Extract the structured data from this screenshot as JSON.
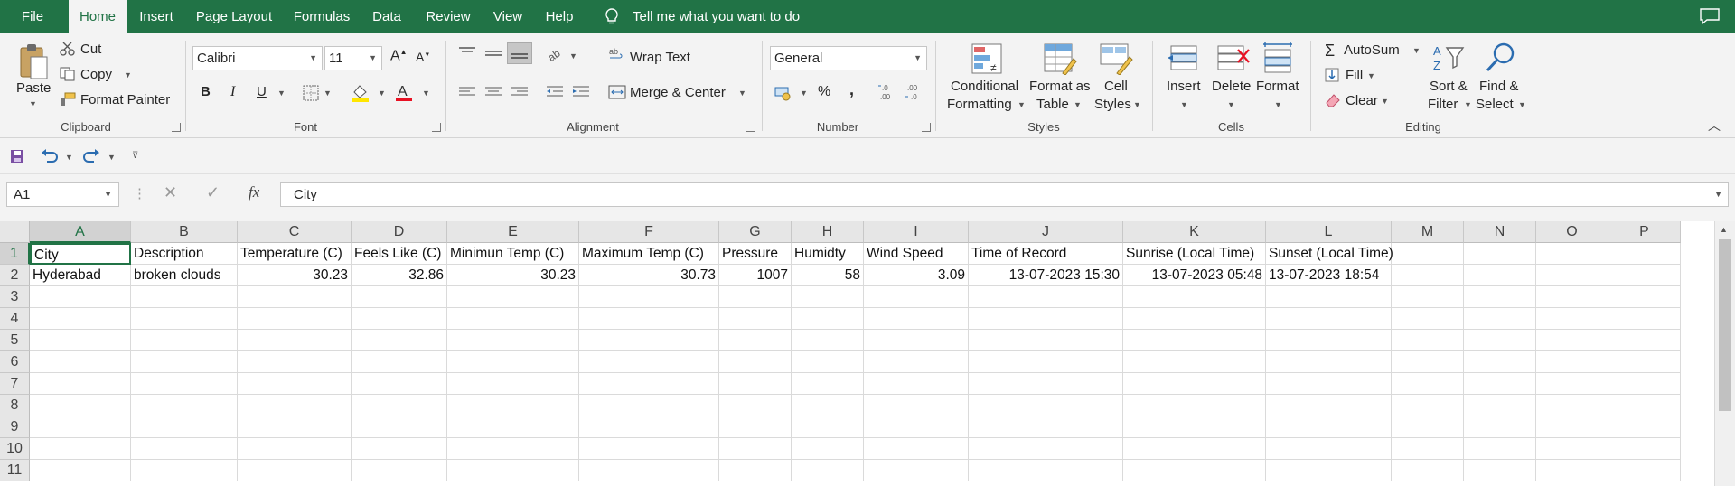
{
  "tabs": [
    "File",
    "Home",
    "Insert",
    "Page Layout",
    "Formulas",
    "Data",
    "Review",
    "View",
    "Help"
  ],
  "active_tab": "Home",
  "tell_me": "Tell me what you want to do",
  "ribbon": {
    "clipboard": {
      "paste": "Paste",
      "cut": "Cut",
      "copy": "Copy",
      "format_painter": "Format Painter",
      "label": "Clipboard"
    },
    "font": {
      "name": "Calibri",
      "size": "11",
      "bold": "B",
      "italic": "I",
      "underline": "U",
      "label": "Font"
    },
    "alignment": {
      "wrap_text": "Wrap Text",
      "merge_center": "Merge & Center",
      "label": "Alignment"
    },
    "number": {
      "format": "General",
      "percent": "%",
      "comma": ",",
      "label": "Number"
    },
    "styles": {
      "conditional_1": "Conditional",
      "conditional_2": "Formatting",
      "format_table_1": "Format as",
      "format_table_2": "Table",
      "cell_styles_1": "Cell",
      "cell_styles_2": "Styles",
      "label": "Styles"
    },
    "cells": {
      "insert": "Insert",
      "delete": "Delete",
      "format": "Format",
      "label": "Cells"
    },
    "editing": {
      "autosum": "AutoSum",
      "fill": "Fill",
      "clear": "Clear",
      "sort_1": "Sort &",
      "sort_2": "Filter",
      "find_1": "Find &",
      "find_2": "Select",
      "label": "Editing"
    }
  },
  "formula_bar": {
    "name_box": "A1",
    "content": "City",
    "fx": "fx"
  },
  "columns": [
    "A",
    "B",
    "C",
    "D",
    "E",
    "F",
    "G",
    "H",
    "I",
    "J",
    "K",
    "L",
    "M",
    "N",
    "O",
    "P"
  ],
  "rows": [
    "1",
    "2",
    "3",
    "4",
    "5",
    "6",
    "7",
    "8",
    "9",
    "10",
    "11"
  ],
  "cells": {
    "r1": [
      "City",
      "Description",
      "Temperature (C)",
      "Feels Like (C)",
      "Minimun Temp (C)",
      "Maximum Temp (C)",
      "Pressure",
      "Humidty",
      "Wind Speed",
      "Time of Record",
      "Sunrise (Local Time)",
      "Sunset (Local Time)"
    ],
    "r2": [
      "Hyderabad",
      "broken clouds",
      "30.23",
      "32.86",
      "30.23",
      "30.73",
      "1007",
      "58",
      "3.09",
      "13-07-2023 15:30",
      "13-07-2023 05:48",
      "13-07-2023 18:54"
    ]
  },
  "colors": {
    "brand": "#217346",
    "font_color": "#e81123",
    "highlight": "#ffe600"
  }
}
